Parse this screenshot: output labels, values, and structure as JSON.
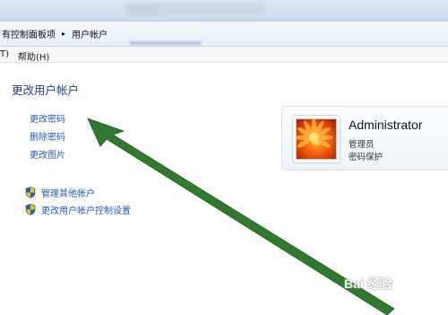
{
  "breadcrumb": {
    "parent": "有控制面板项",
    "separator": "▸",
    "current": "用户帐户"
  },
  "menu": {
    "tools_tail": "T)",
    "help": "帮助(H)"
  },
  "page": {
    "title": "更改用户帐户"
  },
  "tasks": [
    "更改密码",
    "删除密码",
    "更改图片"
  ],
  "admin_links": [
    "管理其他帐户",
    "更改用户帐户控制设置"
  ],
  "user": {
    "name": "Administrator",
    "role": "管理员",
    "status": "密码保护"
  },
  "watermark": "Bai 经验",
  "colors": {
    "link": "#1c5db4",
    "title": "#1e3f86",
    "annotation_arrow": "#2f7a2f"
  },
  "icons": [
    "breadcrumb-separator-icon",
    "shield-icon",
    "user-avatar-flower-icon",
    "annotation-arrow-icon"
  ]
}
